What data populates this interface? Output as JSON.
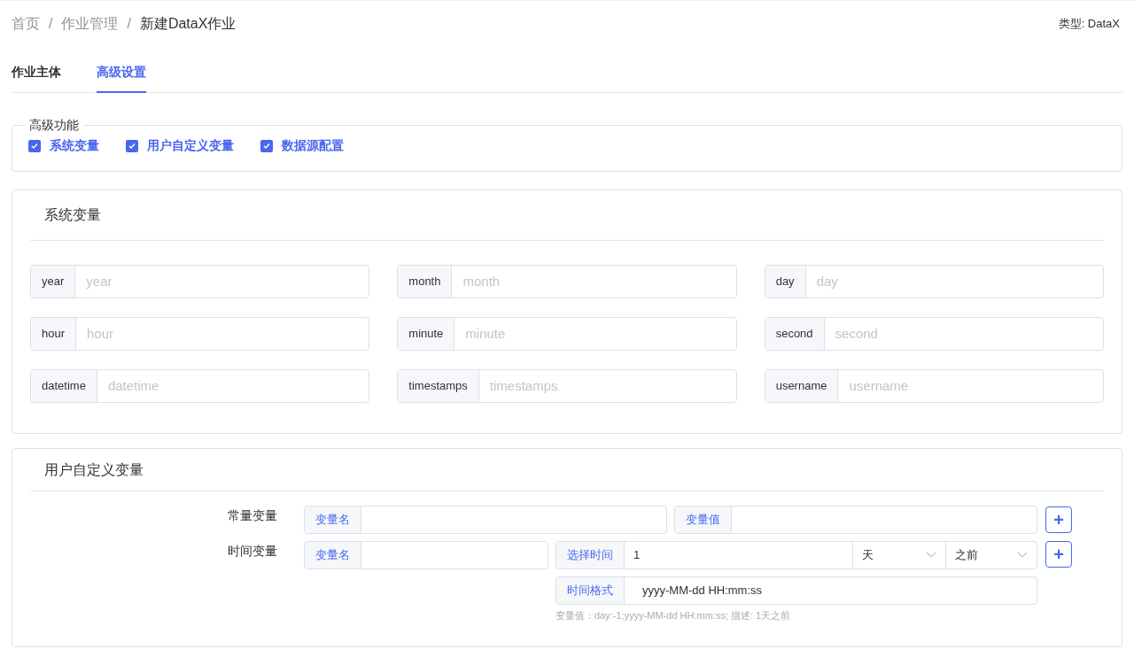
{
  "breadcrumb": [
    {
      "label": "首页",
      "current": false
    },
    {
      "label": "作业管理",
      "current": false
    },
    {
      "label": "新建DataX作业",
      "current": true
    }
  ],
  "breadcrumb_separator": "/",
  "type_label": "类型: DataX",
  "tabs": [
    {
      "label": "作业主体",
      "selected": false
    },
    {
      "label": "高级设置",
      "selected": true
    }
  ],
  "advanced": {
    "legend": "高级功能",
    "options": [
      {
        "label": "系统变量",
        "checked": true
      },
      {
        "label": "用户自定义变量",
        "checked": true
      },
      {
        "label": "数据源配置",
        "checked": true
      }
    ]
  },
  "system_vars": {
    "title": "系统变量",
    "fields": [
      {
        "label": "year",
        "placeholder": "year"
      },
      {
        "label": "month",
        "placeholder": "month"
      },
      {
        "label": "day",
        "placeholder": "day"
      },
      {
        "label": "hour",
        "placeholder": "hour"
      },
      {
        "label": "minute",
        "placeholder": "minute"
      },
      {
        "label": "second",
        "placeholder": "second"
      },
      {
        "label": "datetime",
        "placeholder": "datetime"
      },
      {
        "label": "timestamps",
        "placeholder": "timestamps"
      },
      {
        "label": "username",
        "placeholder": "username"
      }
    ]
  },
  "user_vars": {
    "title": "用户自定义变量",
    "constant": {
      "label": "常量变量",
      "name_addon": "变量名",
      "value_addon": "变量值",
      "add": "+"
    },
    "time": {
      "label": "时间变量",
      "name_addon": "变量名",
      "time_addon": "选择时间",
      "time_value": "1",
      "unit": "天",
      "direction": "之前",
      "format_addon": "时间格式",
      "format_value": "yyyy-MM-dd HH:mm:ss",
      "hint": "变量值：day:-1;yyyy-MM-dd HH:mm:ss; 描述: 1天之前",
      "add": "+"
    }
  }
}
